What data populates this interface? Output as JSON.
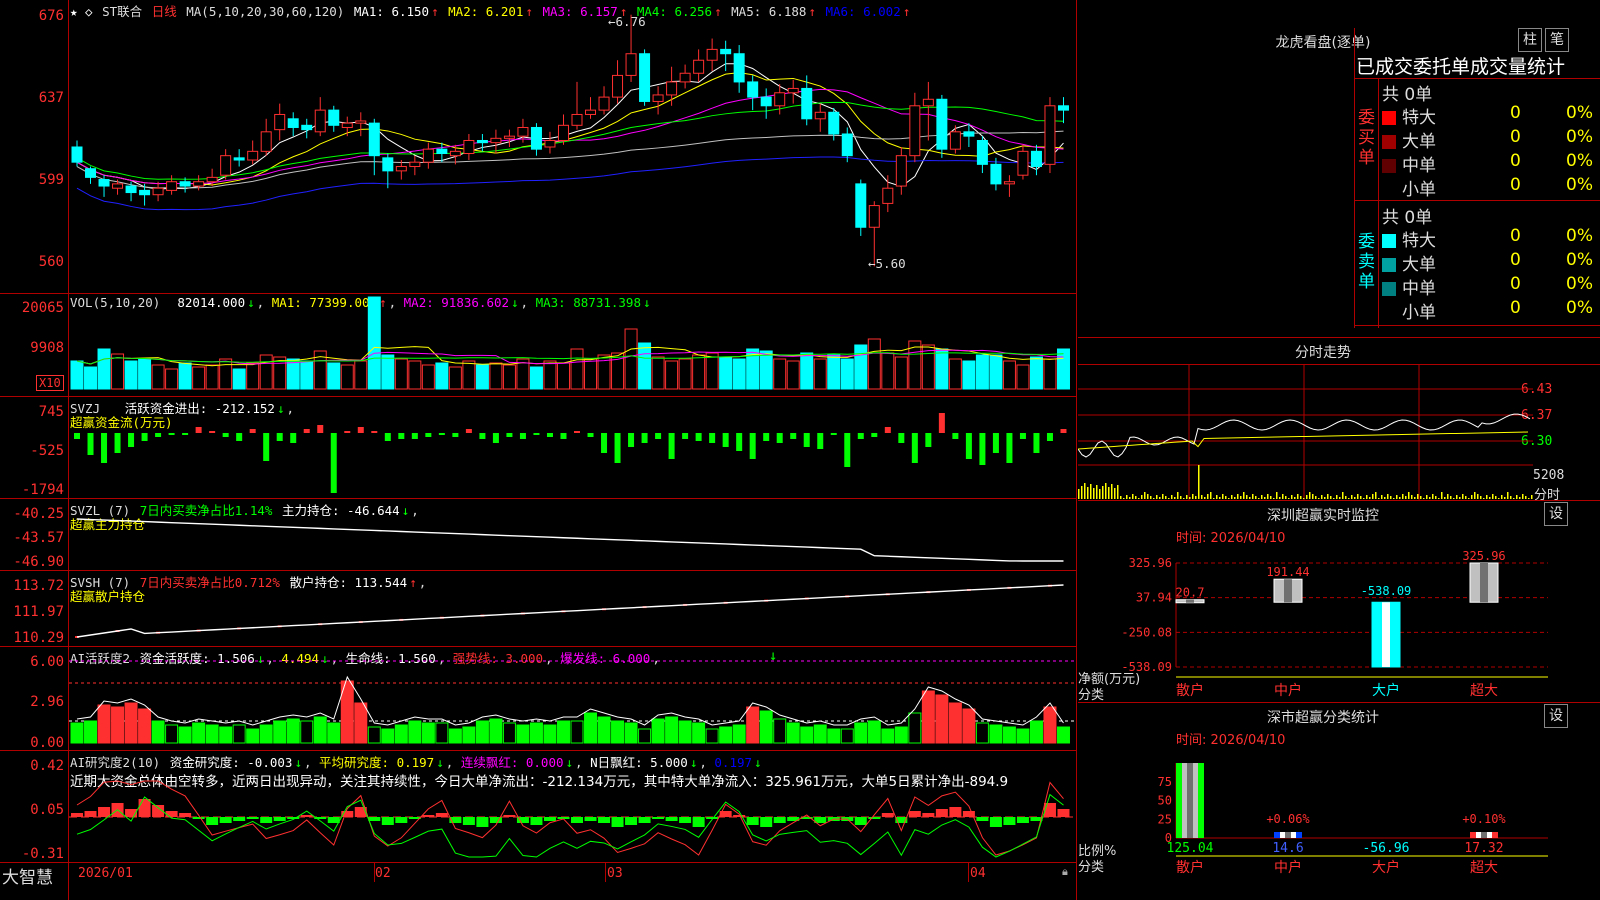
{
  "header": {
    "title": "ST联合",
    "period": "日线",
    "ma_label": "MA(5,10,20,30,60,120)",
    "ma": [
      {
        "name": "MA1",
        "value": "6.150",
        "color": "#ffffff"
      },
      {
        "name": "MA2",
        "value": "6.201",
        "color": "#ffff00"
      },
      {
        "name": "MA3",
        "value": "6.157",
        "color": "#ff00ff"
      },
      {
        "name": "MA4",
        "value": "6.256",
        "color": "#00ff00"
      },
      {
        "name": "MA5",
        "value": "6.188",
        "color": "#c0c0c0"
      },
      {
        "name": "MA6",
        "value": "6.002",
        "color": "#0000ff"
      }
    ],
    "up_arrow": "↑",
    "down_arrow": "↓"
  },
  "price_axis": [
    "676",
    "637",
    "599",
    "560"
  ],
  "price_annotations": {
    "high": "6.76",
    "low": "5.60"
  },
  "vol_panel": {
    "label": "VOL(5,10,20)",
    "value": "82014.000",
    "ma1": "MA1: 77399.000",
    "ma2": "MA2: 91836.602",
    "ma3": "MA3: 88731.398",
    "axis": [
      "20065",
      "9908"
    ],
    "unit": "X10"
  },
  "svzj_panel": {
    "label": "SVZJ",
    "text": "活跃资金进出: -212.152",
    "sub": "超赢资金流(万元)",
    "axis": [
      "745",
      "-525",
      "-1794"
    ]
  },
  "svzl_panel": {
    "label": "SVZL (7)",
    "ratio": "7日内买卖净占比1.14%",
    "text": "主力持仓: -46.644",
    "sub": "超赢主力持仓",
    "axis": [
      "-40.25",
      "-43.57",
      "-46.90"
    ]
  },
  "svsh_panel": {
    "label": "SVSH (7)",
    "ratio": "7日内买卖净占比0.712%",
    "text": "散户持仓: 113.544",
    "sub": "超赢散户持仓",
    "axis": [
      "113.72",
      "111.97",
      "110.29"
    ]
  },
  "ai_panel": {
    "label": "AI活跃度2",
    "text1": "资金活跃度: 1.506",
    "text2": "4.494",
    "text3": "生命线: 1.560",
    "text4": "强势线: 3.000",
    "text5": "爆发线: 6.000",
    "axis": [
      "6.00",
      "2.96",
      "0.00"
    ]
  },
  "ai_research": {
    "label": "AI研究度2(10)",
    "t1": "资金研究度: -0.003",
    "t2": "平均研究度: 0.197",
    "t3": "连续飘红: 0.000",
    "t4": "N日飘红: 5.000",
    "t5": "0.197",
    "comment": "近期大资金总体由空转多，近两日出现异动，关注其持续性，今日大单净流出：-212.134万元，其中特大单净流入：325.961万元，大单5日累计净出-894.9",
    "axis": [
      "0.42",
      "0.05",
      "-0.31"
    ]
  },
  "x_axis": [
    "2026/01",
    "02",
    "03",
    "04"
  ],
  "brand": "大智慧",
  "dragon_panel": {
    "title": "龙虎看盘(逐单)",
    "btn1": "柱",
    "btn2": "笔",
    "tabs": "已成交委托单成交量统计",
    "buy_label": "委买单",
    "sell_label": "委卖单",
    "buy_total": "共 0单",
    "sell_total": "共 0单",
    "buy_rows": [
      {
        "name": "特大",
        "count": "0",
        "pct": "0%",
        "color": "#ff0000"
      },
      {
        "name": "大单",
        "count": "0",
        "pct": "0%",
        "color": "#a00000"
      },
      {
        "name": "中单",
        "count": "0",
        "pct": "0%",
        "color": "#600000"
      },
      {
        "name": "小单",
        "count": "0",
        "pct": "0%",
        "color": ""
      }
    ],
    "sell_rows": [
      {
        "name": "特大",
        "count": "0",
        "pct": "0%",
        "color": "#00ffff"
      },
      {
        "name": "大单",
        "count": "0",
        "pct": "0%",
        "color": "#00a0a0"
      },
      {
        "name": "中单",
        "count": "0",
        "pct": "0%",
        "color": "#008080"
      },
      {
        "name": "小单",
        "count": "0",
        "pct": "0%",
        "color": ""
      }
    ]
  },
  "intraday": {
    "title": "分时走势",
    "axis": [
      "6.43",
      "6.37",
      "6.30"
    ],
    "vol": "5208",
    "vol_label": "分时"
  },
  "sz_monitor": {
    "title": "深圳超赢实时监控",
    "btn": "设",
    "time": "时间: 2026/04/10",
    "axis": [
      "325.96",
      "37.94",
      "-250.08",
      "-538.09"
    ],
    "ylabel1": "净额(万元)",
    "ylabel2": "分类"
  },
  "sz_stats": {
    "title": "深市超赢分类统计",
    "btn": "设",
    "time": "时间: 2026/04/10",
    "axis": [
      "75",
      "50",
      "25",
      "0"
    ],
    "ylabel1": "比例%",
    "ylabel2": "分类",
    "pct_labels": [
      "+0.06%",
      "+0.10%"
    ]
  },
  "chart_data": [
    {
      "type": "candlestick",
      "title": "ST联合 日线",
      "ylim": [
        5.5,
        6.8
      ],
      "candles": [
        [
          6.15,
          6.08,
          6.18,
          6.06
        ],
        [
          6.05,
          6.01,
          6.06,
          5.98
        ],
        [
          6.0,
          5.97,
          6.02,
          5.92
        ],
        [
          5.96,
          5.98,
          6.0,
          5.93
        ],
        [
          5.97,
          5.94,
          5.99,
          5.9
        ],
        [
          5.95,
          5.93,
          5.98,
          5.88
        ],
        [
          5.93,
          5.96,
          5.99,
          5.9
        ],
        [
          5.95,
          5.99,
          6.02,
          5.93
        ],
        [
          5.99,
          5.97,
          6.01,
          5.94
        ],
        [
          5.97,
          5.99,
          6.02,
          5.95
        ],
        [
          5.99,
          6.01,
          6.05,
          5.97
        ],
        [
          6.02,
          6.11,
          6.14,
          6.0
        ],
        [
          6.1,
          6.09,
          6.14,
          6.06
        ],
        [
          6.09,
          6.13,
          6.18,
          6.07
        ],
        [
          6.13,
          6.22,
          6.28,
          6.11
        ],
        [
          6.23,
          6.3,
          6.35,
          6.18
        ],
        [
          6.28,
          6.24,
          6.31,
          6.2
        ],
        [
          6.25,
          6.23,
          6.28,
          6.19
        ],
        [
          6.22,
          6.32,
          6.38,
          6.2
        ],
        [
          6.32,
          6.25,
          6.34,
          6.22
        ],
        [
          6.24,
          6.26,
          6.29,
          6.2
        ],
        [
          6.26,
          6.27,
          6.31,
          6.2
        ],
        [
          6.26,
          6.11,
          6.28,
          6.02
        ],
        [
          6.1,
          6.04,
          6.12,
          5.96
        ],
        [
          6.04,
          6.06,
          6.09,
          6.0
        ],
        [
          6.06,
          6.08,
          6.11,
          6.02
        ],
        [
          6.08,
          6.14,
          6.17,
          6.05
        ],
        [
          6.14,
          6.12,
          6.17,
          6.08
        ],
        [
          6.11,
          6.13,
          6.16,
          6.07
        ],
        [
          6.12,
          6.18,
          6.21,
          6.09
        ],
        [
          6.18,
          6.17,
          6.21,
          6.13
        ],
        [
          6.17,
          6.19,
          6.23,
          6.12
        ],
        [
          6.19,
          6.2,
          6.23,
          6.15
        ],
        [
          6.2,
          6.24,
          6.28,
          6.17
        ],
        [
          6.24,
          6.14,
          6.26,
          6.11
        ],
        [
          6.15,
          6.18,
          6.22,
          6.12
        ],
        [
          6.18,
          6.25,
          6.3,
          6.16
        ],
        [
          6.25,
          6.3,
          6.45,
          6.23
        ],
        [
          6.3,
          6.32,
          6.38,
          6.28
        ],
        [
          6.32,
          6.38,
          6.43,
          6.3
        ],
        [
          6.38,
          6.48,
          6.55,
          6.35
        ],
        [
          6.48,
          6.58,
          6.76,
          6.45
        ],
        [
          6.58,
          6.36,
          6.6,
          6.34
        ],
        [
          6.36,
          6.39,
          6.43,
          6.3
        ],
        [
          6.39,
          6.45,
          6.52,
          6.34
        ],
        [
          6.45,
          6.49,
          6.53,
          6.42
        ],
        [
          6.49,
          6.55,
          6.6,
          6.45
        ],
        [
          6.55,
          6.6,
          6.65,
          6.5
        ],
        [
          6.6,
          6.58,
          6.64,
          6.5
        ],
        [
          6.58,
          6.45,
          6.62,
          6.4
        ],
        [
          6.45,
          6.38,
          6.48,
          6.32
        ],
        [
          6.38,
          6.34,
          6.42,
          6.28
        ],
        [
          6.34,
          6.4,
          6.44,
          6.3
        ],
        [
          6.4,
          6.42,
          6.46,
          6.35
        ],
        [
          6.42,
          6.28,
          6.48,
          6.25
        ],
        [
          6.28,
          6.31,
          6.35,
          6.22
        ],
        [
          6.31,
          6.21,
          6.33,
          6.18
        ],
        [
          6.21,
          6.11,
          6.24,
          6.08
        ],
        [
          5.98,
          5.78,
          6.0,
          5.74
        ],
        [
          5.78,
          5.88,
          5.9,
          5.6
        ],
        [
          5.89,
          5.96,
          6.02,
          5.85
        ],
        [
          5.97,
          6.11,
          6.15,
          5.93
        ],
        [
          6.11,
          6.34,
          6.4,
          6.08
        ],
        [
          6.34,
          6.37,
          6.45,
          6.18
        ],
        [
          6.37,
          6.14,
          6.39,
          6.1
        ],
        [
          6.14,
          6.22,
          6.25,
          6.12
        ],
        [
          6.22,
          6.2,
          6.26,
          6.15
        ],
        [
          6.18,
          6.07,
          6.2,
          6.03
        ],
        [
          6.07,
          5.98,
          6.1,
          5.95
        ],
        [
          5.98,
          5.99,
          6.02,
          5.92
        ],
        [
          6.02,
          6.13,
          6.16,
          6.0
        ],
        [
          6.13,
          6.06,
          6.16,
          6.02
        ],
        [
          6.07,
          6.34,
          6.38,
          6.03
        ],
        [
          6.34,
          6.32,
          6.38,
          6.26
        ]
      ],
      "annotations": [
        "6.76",
        "5.60"
      ]
    },
    {
      "type": "bar",
      "title": "深圳超赢实时监控",
      "categories": [
        "散户",
        "中户",
        "大户",
        "超大"
      ],
      "values": [
        20.7,
        191.44,
        -538.09,
        325.96
      ],
      "ylim": [
        -538.09,
        325.96
      ]
    },
    {
      "type": "bar",
      "title": "深市超赢分类统计",
      "categories": [
        "散户",
        "中户",
        "大户",
        "超大"
      ],
      "values": [
        125.04,
        14.6,
        -56.96,
        17.32
      ]
    }
  ]
}
